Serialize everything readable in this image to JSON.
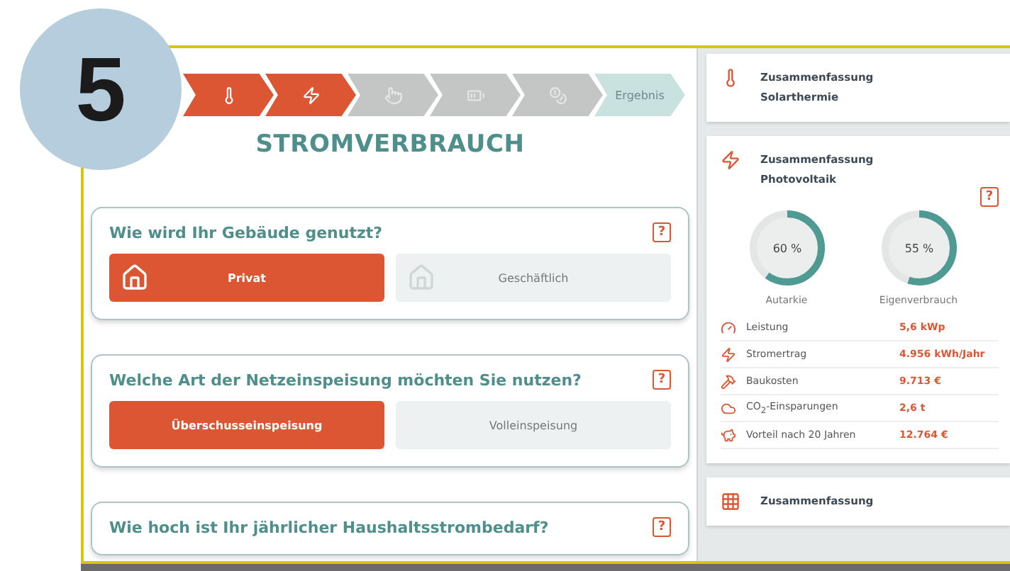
{
  "badge": "5",
  "steps": [
    {
      "kind": "icon",
      "completed": true
    },
    {
      "kind": "icon",
      "completed": true
    },
    {
      "kind": "icon",
      "completed": false
    },
    {
      "kind": "icon",
      "completed": false
    },
    {
      "kind": "icon",
      "completed": false
    },
    {
      "kind": "result",
      "label": "Ergebnis"
    }
  ],
  "title": "STROMVERBRAUCH",
  "questions": [
    {
      "kind": "icon-options",
      "title": "Wie wird Ihr Gebäude genutzt?",
      "help": "?",
      "options": [
        {
          "label": "Privat",
          "selected": true
        },
        {
          "label": "Geschäftlich",
          "selected": false
        }
      ]
    },
    {
      "kind": "plain-options",
      "title": "Welche Art der Netzeinspeisung möchten Sie nutzen?",
      "help": "?",
      "options": [
        {
          "label": "Überschusseinspeisung",
          "selected": true
        },
        {
          "label": "Volleinspeisung",
          "selected": false
        }
      ]
    },
    {
      "title": "Wie hoch ist Ihr jährlicher Haushaltsstrombedarf?",
      "help": "?"
    }
  ],
  "summaries": [
    {
      "kind": "collapsed",
      "title": "Zusammenfassung",
      "subtitle": "Solarthermie"
    },
    {
      "kind": "expanded",
      "title": "Zusammenfassung",
      "subtitle": "Photovoltaik",
      "help": "?",
      "gauges": [
        {
          "value": "60 %",
          "label": "Autarkie",
          "level": 0.6
        },
        {
          "value": "55 %",
          "label": "Eigenverbrauch",
          "level": 0.55
        }
      ],
      "stats": [
        {
          "label": "Leistung",
          "value": "5,6 kWp"
        },
        {
          "label": "Stromertrag",
          "value": "4.956 kWh/Jahr"
        },
        {
          "label": "Baukosten",
          "value": "9.713 €"
        },
        {
          "label": "CO$_{2}$-Einsparungen",
          "value": "2,6 t"
        },
        {
          "label": "Vorteil nach 20 Jahren",
          "value": "12.764 €"
        }
      ]
    },
    {
      "kind": "collapsed",
      "title": "Zusammenfassung"
    }
  ]
}
